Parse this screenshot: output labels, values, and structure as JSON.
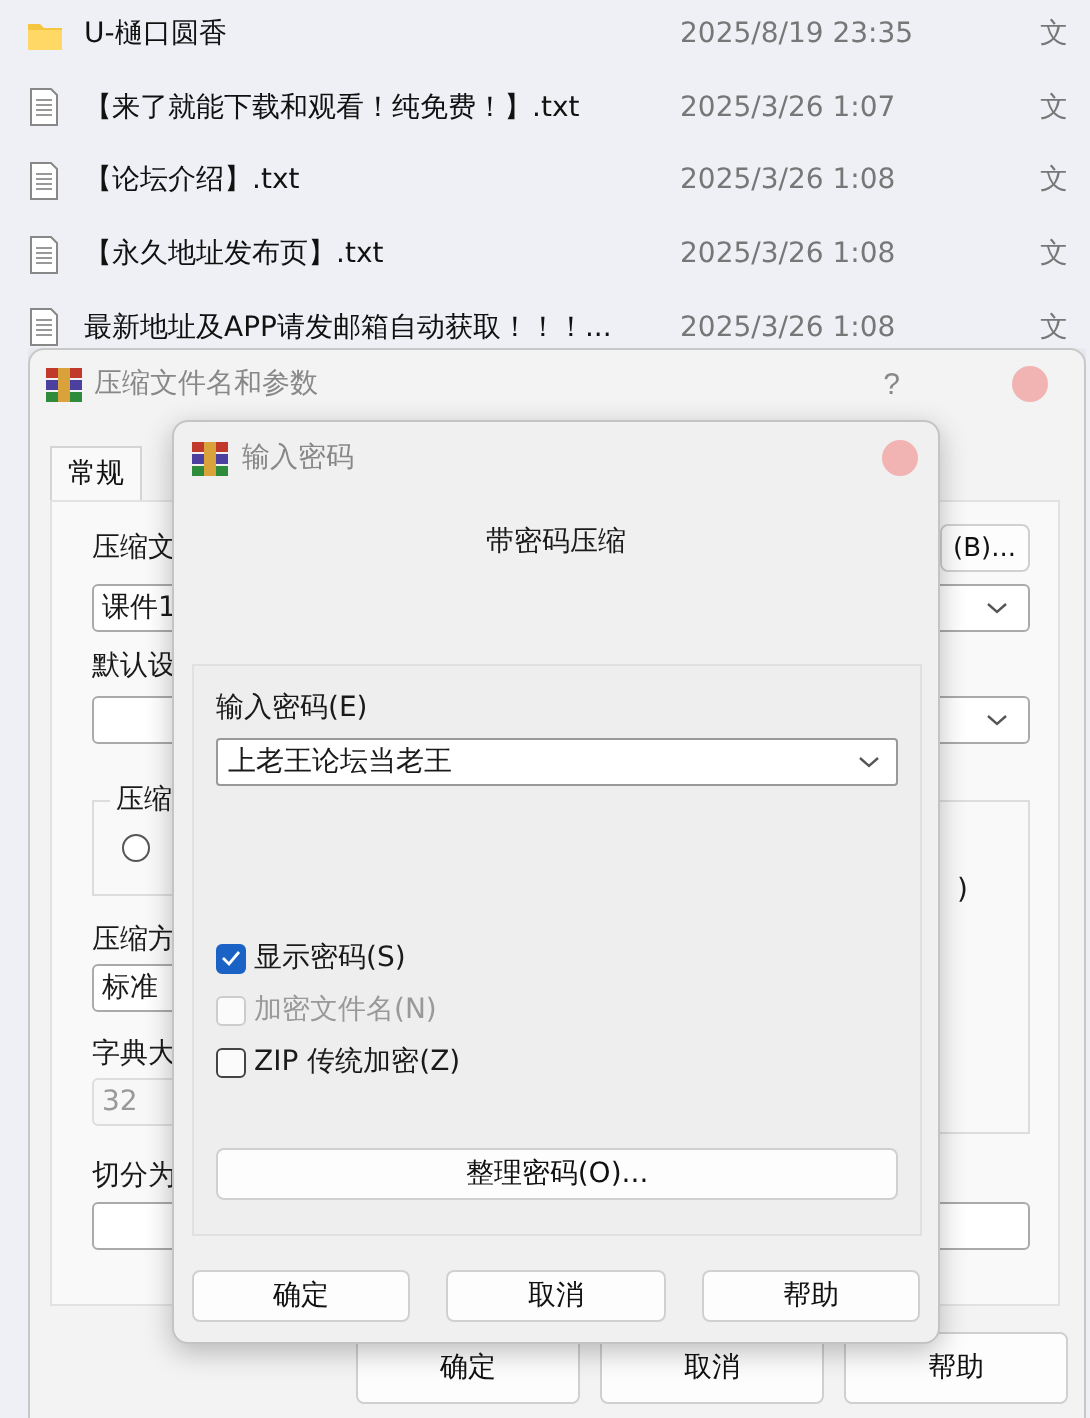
{
  "explorer": {
    "files": [
      {
        "kind": "folder",
        "name": "U-樋口圆香",
        "modified": "2025/8/19 23:35",
        "type": "文"
      },
      {
        "kind": "text",
        "name": "【来了就能下载和观看！纯免费！】.txt",
        "modified": "2025/3/26 1:07",
        "type": "文"
      },
      {
        "kind": "text",
        "name": "【论坛介绍】.txt",
        "modified": "2025/3/26 1:08",
        "type": "文"
      },
      {
        "kind": "text",
        "name": "【永久地址发布页】.txt",
        "modified": "2025/3/26 1:08",
        "type": "文"
      },
      {
        "kind": "text",
        "name": "最新地址及APP请发邮箱自动获取！！！...",
        "modified": "2025/3/26 1:08",
        "type": "文"
      }
    ]
  },
  "archive_dialog": {
    "title": "压缩文件名和参数",
    "help_button": "?",
    "tabs": [
      {
        "label": "常规",
        "selected": true
      }
    ],
    "filename_label": "压缩文",
    "browse_button": "(B)...",
    "filename_value": "课件1",
    "profile_label": "默认设",
    "method_group_label": "压缩",
    "format_radio": {
      "selected": false
    },
    "options_group_text": ")",
    "method_label": "压缩方",
    "method_value": "标准",
    "dictionary_label": "字典大",
    "dictionary_value": "32",
    "dictionary_disabled": true,
    "split_label": "切分为",
    "buttons": [
      "确定",
      "取消",
      "帮助"
    ]
  },
  "password_dialog": {
    "title": "输入密码",
    "heading": "带密码压缩",
    "password_label": "输入密码(E)",
    "password_value": "上老王论坛当老王",
    "options": [
      {
        "label": "显示密码(S)",
        "checked": true,
        "disabled": false
      },
      {
        "label": "加密文件名(N)",
        "checked": false,
        "disabled": true
      },
      {
        "label": "ZIP 传统加密(Z)",
        "checked": false,
        "disabled": false
      }
    ],
    "manage_button": "整理密码(O)...",
    "buttons": [
      "确定",
      "取消",
      "帮助"
    ]
  }
}
